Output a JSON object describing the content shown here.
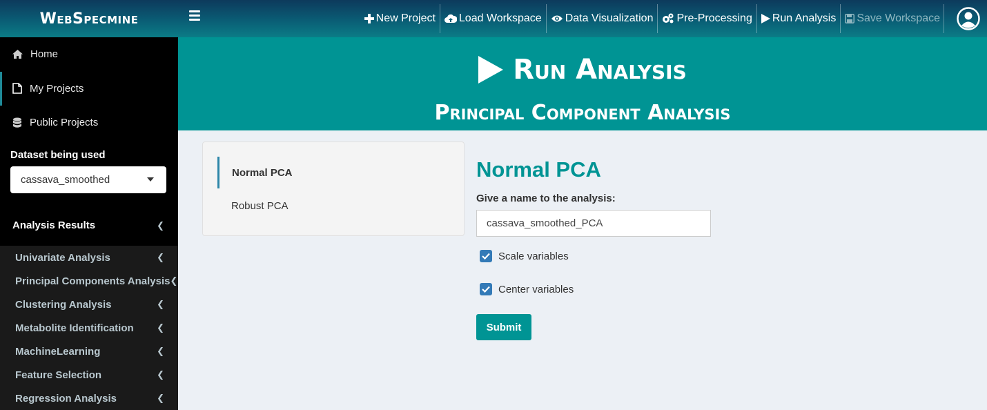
{
  "app": {
    "logo": "WebSpecmine"
  },
  "topnav": [
    {
      "label": "New Project",
      "icon": "plus-icon",
      "enabled": true
    },
    {
      "label": "Load Workspace",
      "icon": "cloud-upload-icon",
      "enabled": true
    },
    {
      "label": "Data Visualization",
      "icon": "eye-icon",
      "enabled": true
    },
    {
      "label": "Pre-Processing",
      "icon": "gears-icon",
      "enabled": true
    },
    {
      "label": "Run Analysis",
      "icon": "play-icon",
      "enabled": true
    },
    {
      "label": "Save Workspace",
      "icon": "save-icon",
      "enabled": false
    }
  ],
  "sidebar": {
    "links": [
      {
        "label": "Home",
        "icon": "home-icon"
      },
      {
        "label": "My Projects",
        "icon": "file-icon"
      },
      {
        "label": "Public Projects",
        "icon": "database-icon"
      }
    ],
    "dataset_label": "Dataset being used",
    "dataset_value": "cassava_smoothed",
    "analysis_results_label": "Analysis Results",
    "analysis_items": [
      "Univariate Analysis",
      "Principal Components Analysis",
      "Clustering Analysis",
      "Metabolite Identification",
      "MachineLearning",
      "Feature Selection",
      "Regression Analysis"
    ]
  },
  "header": {
    "title": "Run Analysis",
    "subtitle": "Principal Component Analysis"
  },
  "tabs": [
    {
      "label": "Normal PCA",
      "active": true
    },
    {
      "label": "Robust PCA",
      "active": false
    }
  ],
  "form": {
    "heading": "Normal PCA",
    "name_label": "Give a name to the analysis:",
    "name_value": "cassava_smoothed_PCA",
    "scale_label": "Scale variables",
    "scale_checked": true,
    "center_label": "Center variables",
    "center_checked": true,
    "submit_label": "Submit"
  },
  "colors": {
    "teal": "#009494",
    "checkbox": "#337ab7",
    "sidebar_bg": "#000000"
  }
}
